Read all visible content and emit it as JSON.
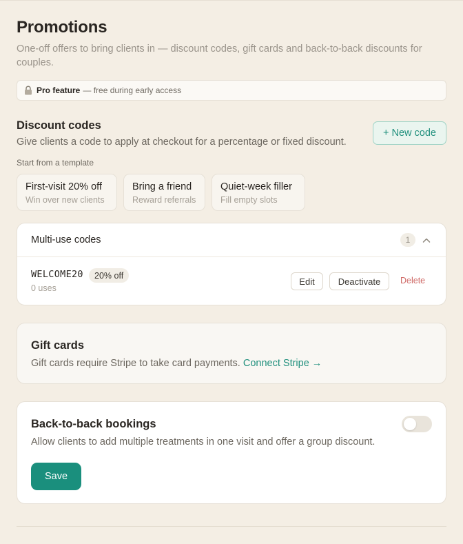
{
  "page": {
    "title": "Promotions",
    "subtitle": "One-off offers to bring clients in — discount codes, gift cards and back-to-back discounts for couples."
  },
  "pro_banner": {
    "icon": "lock-icon",
    "strong": "Pro feature",
    "text": "— free during early access"
  },
  "discount_codes": {
    "title": "Discount codes",
    "description": "Give clients a code to apply at checkout for a percentage or fixed discount.",
    "new_code_label": "+ New code",
    "templates_label": "Start from a template",
    "templates": [
      {
        "name": "First-visit 20% off",
        "sub": "Win over new clients"
      },
      {
        "name": "Bring a friend",
        "sub": "Reward referrals"
      },
      {
        "name": "Quiet-week filler",
        "sub": "Fill empty slots"
      }
    ]
  },
  "multi_use": {
    "title": "Multi-use codes",
    "count": "1",
    "codes": [
      {
        "code": "WELCOME20",
        "discount": "20% off",
        "uses": "0 uses",
        "edit_label": "Edit",
        "deactivate_label": "Deactivate",
        "delete_label": "Delete"
      }
    ]
  },
  "gift_cards": {
    "title": "Gift cards",
    "text": "Gift cards require Stripe to take card payments.",
    "link_label": "Connect Stripe →"
  },
  "back_to_back": {
    "title": "Back-to-back bookings",
    "description": "Allow clients to add multiple treatments in one visit and offer a group discount.",
    "enabled": false,
    "save_label": "Save"
  },
  "colors": {
    "background": "#f4eee4",
    "accent": "#1a8f7d",
    "link": "#1f8f7c",
    "danger": "#d06b68"
  }
}
